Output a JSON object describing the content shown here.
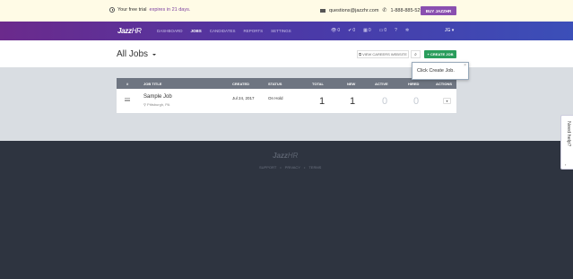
{
  "banner": {
    "trial_prefix": "Your free trial",
    "trial_link": "expires in 21 days.",
    "email": "questions@jazzhr.com",
    "phone": "1-888-885-5299",
    "buy_label": "BUY JAZZHR"
  },
  "nav": {
    "logo_main": "Jazz",
    "logo_suffix": "HR",
    "items": [
      "DASHBOARD",
      "JOBS",
      "CANDIDATES",
      "REPORTS",
      "SETTINGS"
    ],
    "active": "JOBS",
    "counters": [
      {
        "icon": "eye-icon",
        "glyph": "👁",
        "value": "0"
      },
      {
        "icon": "check-icon",
        "glyph": "✔",
        "value": "0"
      },
      {
        "icon": "calendar-icon",
        "glyph": "▦",
        "value": "0"
      },
      {
        "icon": "inbox-icon",
        "glyph": "▭",
        "value": "0"
      }
    ],
    "help_glyph": "?",
    "settings_glyph": "✲",
    "user_initials": "JG"
  },
  "page": {
    "title": "All Jobs",
    "careers_button": "VIEW CAREERS WEBSITE",
    "search_glyph": "⌕",
    "create_button": "CREATE JOB"
  },
  "tooltip": {
    "text": "Click Create Job.",
    "close": "×"
  },
  "table": {
    "headers": {
      "hash": "#",
      "job_title": "JOB TITLE",
      "created": "CREATED",
      "status": "STATUS",
      "total": "TOTAL",
      "new": "NEW",
      "active": "ACTIVE",
      "hired": "HIRED",
      "actions": "ACTIONS"
    },
    "rows": [
      {
        "title": "Sample Job",
        "location": "Pittsburgh, PA",
        "created": "Jul 24, 2017",
        "status": "On Hold",
        "total": "1",
        "new": "1",
        "active": "0",
        "hired": "0"
      }
    ]
  },
  "footer": {
    "logo_main": "Jazz",
    "logo_suffix": "HR",
    "links": [
      "SUPPORT",
      "PRIVACY",
      "TERMS"
    ]
  },
  "help_tab": {
    "label": "Need help?"
  },
  "colors": {
    "brand_purple": "#6b2a8c",
    "nav_blue": "#3b4fb8",
    "create_green": "#2a9d5c",
    "footer_bg": "#2e3440"
  }
}
